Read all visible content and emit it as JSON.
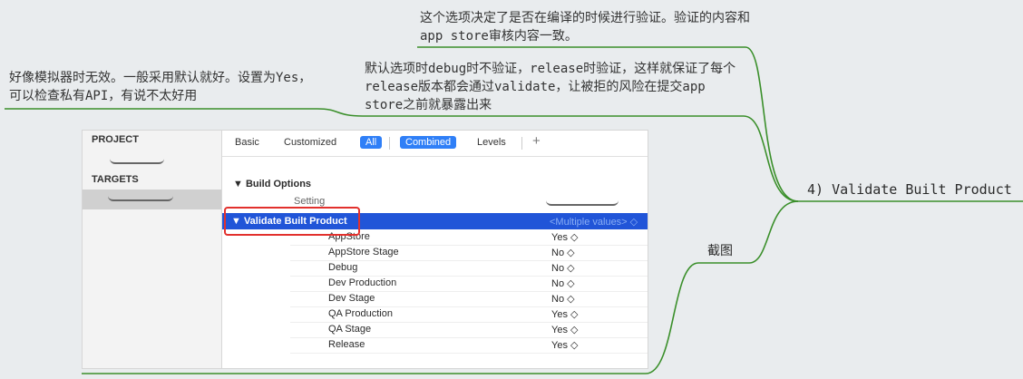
{
  "mindmap": {
    "root": "4) Validate Built Product",
    "branch": "截图",
    "note_top": "这个选项决定了是否在编译的时候进行验证。验证的内容和app store审核内容一致。",
    "note_left": "好像模拟器时无效。一般采用默认就好。设置为Yes，可以检查私有API，有说不太好用",
    "note_mid": "默认选项时debug时不验证，release时验证，这样就保证了每个release版本都会通过validate，让被拒的风险在提交app store之前就暴露出来",
    "line_color": "#3a8f2a"
  },
  "xcode": {
    "sidebar": {
      "project_header": "PROJECT",
      "targets_header": "TARGETS"
    },
    "tabs": {
      "basic": "Basic",
      "customized": "Customized",
      "all": "All",
      "combined": "Combined",
      "levels": "Levels",
      "add": "+"
    },
    "section_title": "▼ Build Options",
    "column_setting": "Setting",
    "selected_row": {
      "name": "▼ Validate Built Product",
      "value": "<Multiple values> ◇"
    },
    "rows": [
      {
        "name": "AppStore",
        "value": "Yes ◇"
      },
      {
        "name": "AppStore Stage",
        "value": "No ◇"
      },
      {
        "name": "Debug",
        "value": "No ◇"
      },
      {
        "name": "Dev Production",
        "value": "No ◇"
      },
      {
        "name": "Dev Stage",
        "value": "No ◇"
      },
      {
        "name": "QA Production",
        "value": "Yes ◇"
      },
      {
        "name": "QA Stage",
        "value": "Yes ◇"
      },
      {
        "name": "Release",
        "value": "Yes ◇"
      }
    ],
    "accent": "#2f7ff7",
    "highlight": "#e2312d"
  }
}
